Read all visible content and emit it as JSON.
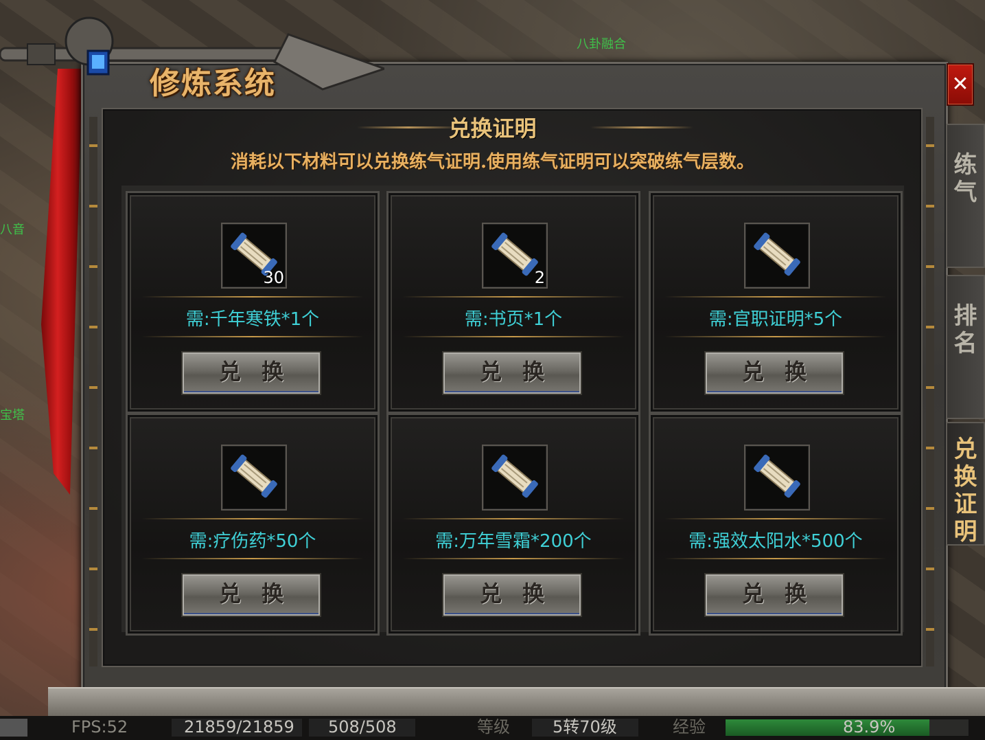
{
  "window": {
    "title": "修炼系统",
    "close_label": "✕"
  },
  "section": {
    "title": "兑换证明",
    "description": "消耗以下材料可以兑换练气证明.使用练气证明可以突破练气层数。"
  },
  "exchange_items": [
    {
      "icon": "scroll-icon",
      "count": "30",
      "requirement": "需:千年寒铁*1个",
      "button": "兑换"
    },
    {
      "icon": "scroll-icon",
      "count": "2",
      "requirement": "需:书页*1个",
      "button": "兑换"
    },
    {
      "icon": "scroll-icon",
      "count": "",
      "requirement": "需:官职证明*5个",
      "button": "兑换"
    },
    {
      "icon": "scroll-icon",
      "count": "",
      "requirement": "需:疗伤药*50个",
      "button": "兑换"
    },
    {
      "icon": "scroll-icon",
      "count": "",
      "requirement": "需:万年雪霜*200个",
      "button": "兑换"
    },
    {
      "icon": "scroll-icon",
      "count": "",
      "requirement": "需:强效太阳水*500个",
      "button": "兑换"
    }
  ],
  "side_tabs": [
    {
      "label": "练气",
      "active": false
    },
    {
      "label": "排名",
      "active": false
    },
    {
      "label": "兑换证明",
      "active": true
    }
  ],
  "scene_labels": {
    "npc1": "八卦融合",
    "npc2": "宝塔",
    "npc3": "八音"
  },
  "status_bar": {
    "fps": "FPS:52",
    "hp": "21859/21859",
    "mp": "508/508",
    "level_label": "等级",
    "level": "5转70级",
    "exp_label": "经验",
    "exp_percent": "83.9%",
    "exp_fraction": 0.839
  },
  "colors": {
    "requirement_text": "#3fd0d6",
    "title_gold": "#e8b46a",
    "close_red": "#c01a10",
    "exp_green": "#2e8a3a"
  }
}
